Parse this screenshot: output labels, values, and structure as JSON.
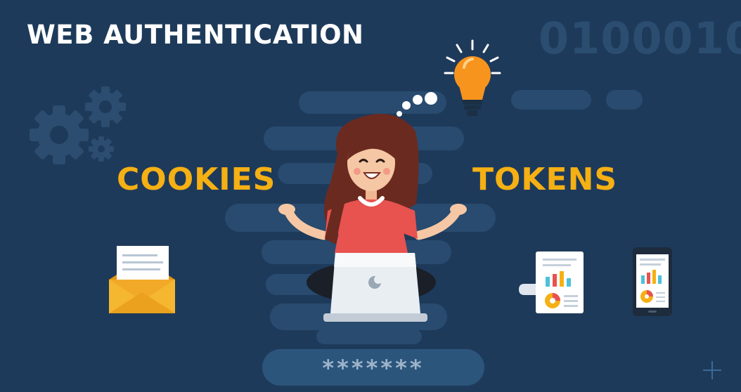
{
  "header": {
    "title": "WEB AUTHENTICATION"
  },
  "background": {
    "binary_text": "0100010"
  },
  "labels": {
    "cookies": "COOKIES",
    "tokens": "TOKENS"
  },
  "password": {
    "masked_value": "*******"
  },
  "colors": {
    "background": "#1e3a5a",
    "accent": "#f5b014",
    "bulb": "#f7941d",
    "shirt": "#e8524f",
    "hair": "#6b2a1f",
    "skin": "#f6c7a4"
  },
  "icons": [
    "gear-icon",
    "lightbulb-icon",
    "envelope-icon",
    "report-icon",
    "smartphone-icon",
    "laptop-icon",
    "plus-icon"
  ]
}
